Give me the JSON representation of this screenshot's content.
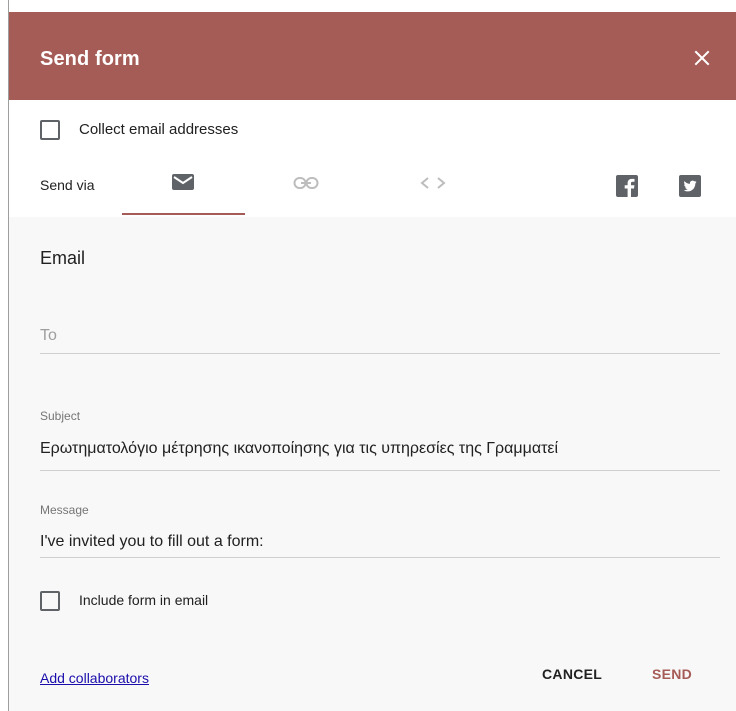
{
  "dialog": {
    "title": "Send form",
    "collect_email_label": "Collect email addresses",
    "send_via_label": "Send via",
    "tabs": [
      {
        "name": "email",
        "icon": "mail-icon",
        "active": true
      },
      {
        "name": "link",
        "icon": "link-icon",
        "active": false
      },
      {
        "name": "embed",
        "icon": "code-icon",
        "active": false
      }
    ],
    "social": [
      {
        "name": "facebook",
        "icon": "facebook-icon"
      },
      {
        "name": "twitter",
        "icon": "twitter-icon"
      }
    ]
  },
  "email": {
    "section_title": "Email",
    "to_placeholder": "To",
    "subject_label": "Subject",
    "subject_value": "Ερωτηματολόγιο μέτρησης ικανοποίησης για τις υπηρεσίες της Γραμματεί",
    "message_label": "Message",
    "message_value": "I've invited you to fill out a form:",
    "include_form_label": "Include form in email"
  },
  "footer": {
    "add_collaborators": "Add collaborators",
    "cancel": "CANCEL",
    "send": "SEND"
  },
  "colors": {
    "header": "#a65c56",
    "accent": "#a65c56",
    "link": "#1a0dab"
  }
}
